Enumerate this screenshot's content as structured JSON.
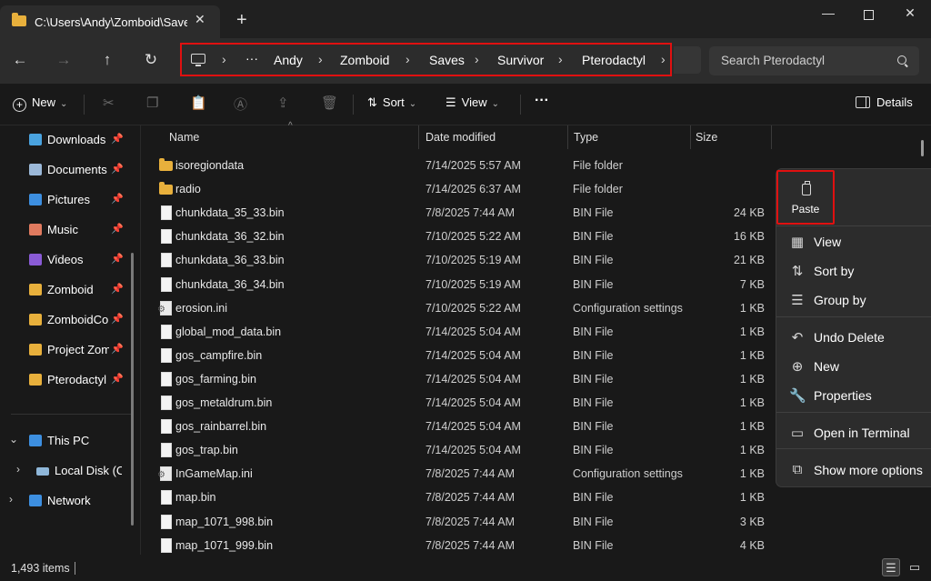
{
  "window": {
    "tab_title": "C:\\Users\\Andy\\Zomboid\\Saves",
    "tab_close": "✕",
    "new_tab": "+",
    "minimize": "—",
    "close": "✕"
  },
  "nav": {
    "back": "←",
    "forward": "→",
    "up": "↑",
    "refresh": "↻"
  },
  "address": {
    "ellipsis": "···",
    "crumbs": [
      "Andy",
      "Zomboid",
      "Saves",
      "Survivor",
      "Pterodactyl"
    ],
    "separator": "›"
  },
  "search": {
    "placeholder": "Search Pterodactyl"
  },
  "toolbar": {
    "new_label": "New",
    "sort_label": "Sort",
    "view_label": "View",
    "more": "···",
    "details_label": "Details"
  },
  "sidebar": {
    "items": [
      {
        "label": "Downloads",
        "color": "#4aa3df"
      },
      {
        "label": "Documents",
        "color": "#9bb8d8"
      },
      {
        "label": "Pictures",
        "color": "#3d8fe0"
      },
      {
        "label": "Music",
        "color": "#e07a5f"
      },
      {
        "label": "Videos",
        "color": "#8a5bd6"
      },
      {
        "label": "Zomboid",
        "color": "#e8b03c"
      },
      {
        "label": "ZomboidConfig",
        "color": "#e8b03c"
      },
      {
        "label": "Project Zomboid",
        "color": "#e8b03c"
      },
      {
        "label": "Pterodactyl",
        "color": "#e8b03c"
      }
    ],
    "this_pc": "This PC",
    "local_disk": "Local Disk (C:)",
    "network": "Network"
  },
  "columns": {
    "name": "Name",
    "date": "Date modified",
    "type": "Type",
    "size": "Size"
  },
  "files": [
    {
      "name": "isoregiondata",
      "date": "7/14/2025 5:57 AM",
      "type": "File folder",
      "size": "",
      "kind": "folder"
    },
    {
      "name": "radio",
      "date": "7/14/2025 6:37 AM",
      "type": "File folder",
      "size": "",
      "kind": "folder"
    },
    {
      "name": "chunkdata_35_33.bin",
      "date": "7/8/2025 7:44 AM",
      "type": "BIN File",
      "size": "24 KB",
      "kind": "file"
    },
    {
      "name": "chunkdata_36_32.bin",
      "date": "7/10/2025 5:22 AM",
      "type": "BIN File",
      "size": "16 KB",
      "kind": "file"
    },
    {
      "name": "chunkdata_36_33.bin",
      "date": "7/10/2025 5:19 AM",
      "type": "BIN File",
      "size": "21 KB",
      "kind": "file"
    },
    {
      "name": "chunkdata_36_34.bin",
      "date": "7/10/2025 5:19 AM",
      "type": "BIN File",
      "size": "7 KB",
      "kind": "file"
    },
    {
      "name": "erosion.ini",
      "date": "7/10/2025 5:22 AM",
      "type": "Configuration settings",
      "size": "1 KB",
      "kind": "config"
    },
    {
      "name": "global_mod_data.bin",
      "date": "7/14/2025 5:04 AM",
      "type": "BIN File",
      "size": "1 KB",
      "kind": "file"
    },
    {
      "name": "gos_campfire.bin",
      "date": "7/14/2025 5:04 AM",
      "type": "BIN File",
      "size": "1 KB",
      "kind": "file"
    },
    {
      "name": "gos_farming.bin",
      "date": "7/14/2025 5:04 AM",
      "type": "BIN File",
      "size": "1 KB",
      "kind": "file"
    },
    {
      "name": "gos_metaldrum.bin",
      "date": "7/14/2025 5:04 AM",
      "type": "BIN File",
      "size": "1 KB",
      "kind": "file"
    },
    {
      "name": "gos_rainbarrel.bin",
      "date": "7/14/2025 5:04 AM",
      "type": "BIN File",
      "size": "1 KB",
      "kind": "file"
    },
    {
      "name": "gos_trap.bin",
      "date": "7/14/2025 5:04 AM",
      "type": "BIN File",
      "size": "1 KB",
      "kind": "file"
    },
    {
      "name": "InGameMap.ini",
      "date": "7/8/2025 7:44 AM",
      "type": "Configuration settings",
      "size": "1 KB",
      "kind": "config"
    },
    {
      "name": "map.bin",
      "date": "7/8/2025 7:44 AM",
      "type": "BIN File",
      "size": "1 KB",
      "kind": "file"
    },
    {
      "name": "map_1071_998.bin",
      "date": "7/8/2025 7:44 AM",
      "type": "BIN File",
      "size": "3 KB",
      "kind": "file"
    },
    {
      "name": "map_1071_999.bin",
      "date": "7/8/2025 7:44 AM",
      "type": "BIN File",
      "size": "4 KB",
      "kind": "file"
    }
  ],
  "context_menu": {
    "paste_label": "Paste",
    "items": [
      {
        "label": "View",
        "icon": "▦"
      },
      {
        "label": "Sort by",
        "icon": "⇅"
      },
      {
        "label": "Group by",
        "icon": "☰"
      },
      {
        "label": "Undo Delete",
        "icon": "↶"
      },
      {
        "label": "New",
        "icon": "⊕"
      },
      {
        "label": "Properties",
        "icon": "🔧"
      },
      {
        "label": "Open in Terminal",
        "icon": "▭"
      },
      {
        "label": "Show more options",
        "icon": "⧉"
      }
    ]
  },
  "status": {
    "items_count": "1,493 items"
  }
}
